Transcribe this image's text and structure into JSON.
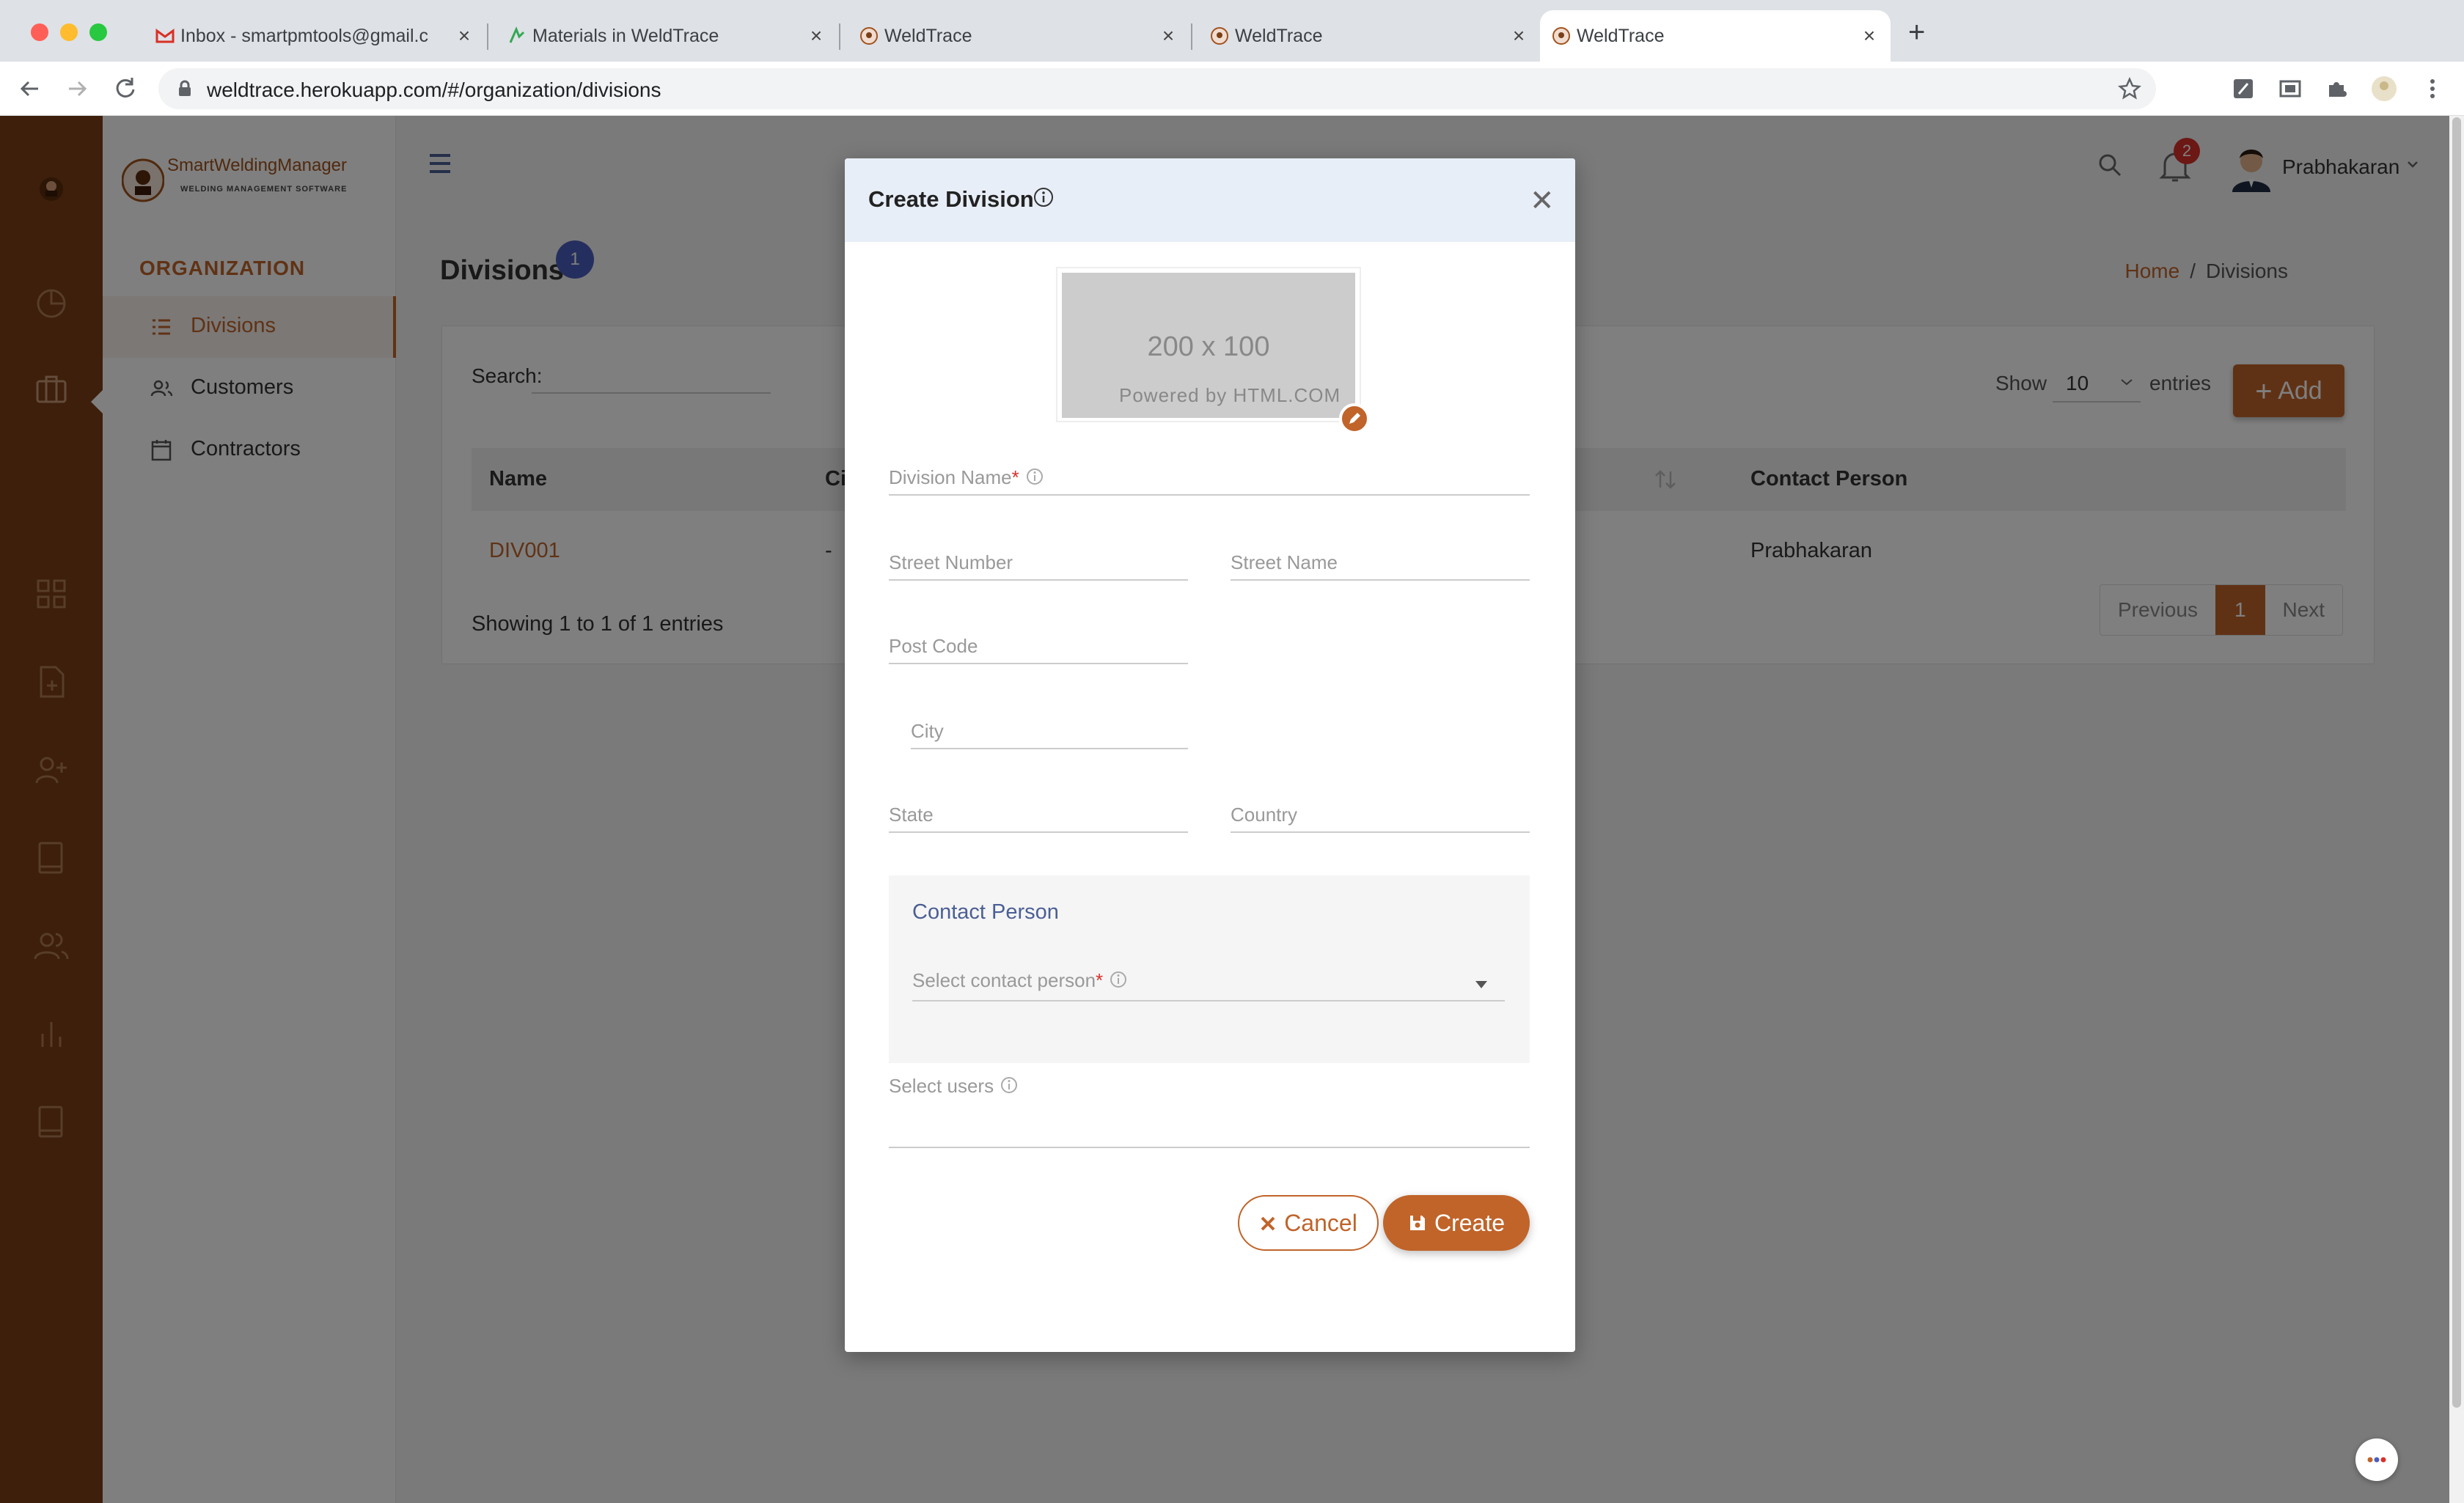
{
  "browser": {
    "tabs": [
      {
        "title": "Inbox - smartpmtools@gmail.c",
        "icon": "gmail-icon"
      },
      {
        "title": "Materials in WeldTrace",
        "icon": "materials-icon"
      },
      {
        "title": "WeldTrace",
        "icon": "weldtrace-icon"
      },
      {
        "title": "WeldTrace",
        "icon": "weldtrace-icon"
      },
      {
        "title": "WeldTrace",
        "icon": "weldtrace-icon",
        "active": true
      }
    ],
    "url": "weldtrace.herokuapp.com/#/organization/divisions"
  },
  "brand": {
    "name": "SmartWeldingManager",
    "tagline": "WELDING MANAGEMENT SOFTWARE"
  },
  "sidenav": {
    "section": "ORGANIZATION",
    "items": [
      {
        "label": "Divisions",
        "icon": "list-icon",
        "active": true
      },
      {
        "label": "Customers",
        "icon": "users-icon"
      },
      {
        "label": "Contractors",
        "icon": "calendar-icon"
      }
    ]
  },
  "header": {
    "notifications": "2",
    "user_name": "Prabhakaran"
  },
  "page": {
    "title": "Divisions",
    "count_badge": "1",
    "breadcrumb": {
      "home": "Home",
      "separator": "/",
      "current": "Divisions"
    }
  },
  "table": {
    "search_label": "Search:",
    "show_label": "Show",
    "entries_value": "10",
    "entries_label": "entries",
    "add_label": "Add",
    "columns": [
      "Name",
      "Ci",
      "Contact Person"
    ],
    "rows": [
      {
        "name": "DIV001",
        "city": "-",
        "contact": "Prabhakaran"
      }
    ],
    "info": "Showing 1 to 1 of 1 entries",
    "pagination": {
      "previous": "Previous",
      "current": "1",
      "next": "Next"
    }
  },
  "modal": {
    "title": "Create Division",
    "image_placeholder": {
      "size": "200 x 100",
      "caption": "Powered by HTML.COM"
    },
    "fields": {
      "division_name": "Division Name",
      "required_mark": "*",
      "street_number": "Street Number",
      "street_name": "Street Name",
      "post_code": "Post Code",
      "city": "City",
      "state": "State",
      "country": "Country"
    },
    "contact_section": {
      "title": "Contact Person",
      "select_placeholder": "Select contact person"
    },
    "select_users": "Select users",
    "cancel_label": "Cancel",
    "create_label": "Create"
  },
  "colors": {
    "accent": "#c0642a",
    "rail": "#7a3f16",
    "badge": "#4b5fbf",
    "modal_header": "#e8eef8"
  }
}
